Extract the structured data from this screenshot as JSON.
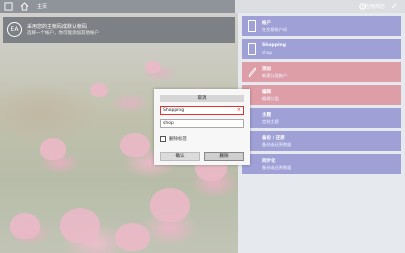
{
  "titlebar": {
    "title": "主页",
    "right_label": "应用商店"
  },
  "header": {
    "logo_text": "EA",
    "line1": "采用您的主帐码成默认帐码",
    "line2": "选择一个帐户，你可能添加其他帐户"
  },
  "tiles": [
    {
      "title": "帐户",
      "subtitle": "在交易帐户间",
      "icon": "file-icon",
      "style": "blue"
    },
    {
      "title": "Shopping",
      "subtitle": "shop",
      "icon": "file-icon",
      "style": "blue"
    },
    {
      "title": "添加",
      "subtitle": "新建分类帐户",
      "icon": "pencil-icon",
      "style": "pink"
    },
    {
      "title": "编辑",
      "subtitle": "编辑分类",
      "icon": "none",
      "style": "pink"
    },
    {
      "title": "主题",
      "subtitle": "定制主题",
      "icon": "none",
      "style": "blue"
    },
    {
      "title": "备份 / 还原",
      "subtitle": "备份或还原数据",
      "icon": "none",
      "style": "blue"
    },
    {
      "title": "同步化",
      "subtitle": "备份或还原数据",
      "icon": "none",
      "style": "blue"
    }
  ],
  "dialog": {
    "header": "取消",
    "name_value": "Shopping",
    "desc_value": "shop",
    "checkbox_label": "删除标签",
    "ok_label": "确认",
    "delete_label": "删除"
  },
  "colors": {
    "tile_blue": "#9ea0d6",
    "tile_pink": "#de9ea8",
    "titlebar": "#8f949b"
  }
}
